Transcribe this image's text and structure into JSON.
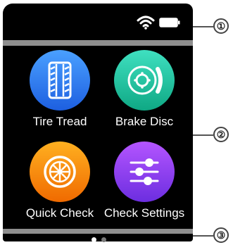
{
  "status_bar": {
    "wifi_icon": "wifi-icon",
    "battery_icon": "battery-icon"
  },
  "apps": [
    {
      "label": "Tire Tread",
      "icon": "tire-tread-icon",
      "color_top": "#4aa0ff",
      "color_bottom": "#1d5fe0"
    },
    {
      "label": "Brake Disc",
      "icon": "brake-disc-icon",
      "color_top": "#3fe0c0",
      "color_bottom": "#0fa884"
    },
    {
      "label": "Quick Check",
      "icon": "wheel-icon",
      "color_top": "#ffb020",
      "color_bottom": "#f06a00"
    },
    {
      "label": "Check Settings",
      "icon": "sliders-icon",
      "color_top": "#b455ff",
      "color_bottom": "#6c2ee0"
    }
  ],
  "pagination": {
    "pages": 2,
    "current": 1
  },
  "callouts": [
    "①",
    "②",
    "③"
  ]
}
